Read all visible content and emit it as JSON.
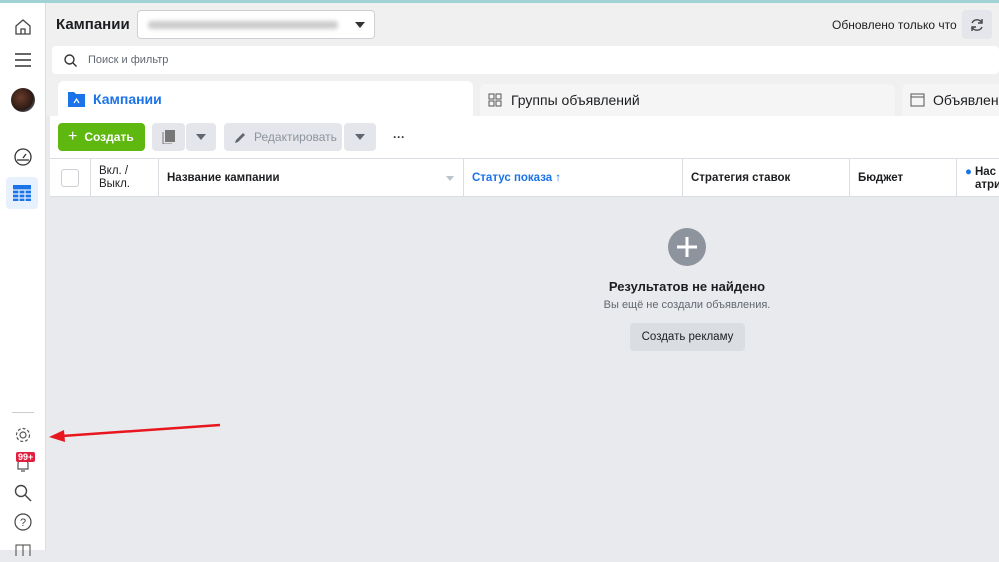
{
  "header": {
    "title": "Кампании",
    "updated": "Обновлено только что"
  },
  "search": {
    "placeholder": "Поиск и фильтр"
  },
  "tabs": [
    {
      "label": "Кампании"
    },
    {
      "label": "Группы объявлений"
    },
    {
      "label": "Объявлен"
    }
  ],
  "toolbar": {
    "create": "Создать",
    "edit": "Редактировать",
    "more": "···"
  },
  "table": {
    "columns": [
      "Вкл. / Выкл.",
      "Название кампании",
      "Статус показа",
      "Стратегия ставок",
      "Бюджет",
      "Нас атрибу"
    ]
  },
  "empty": {
    "title": "Результатов не найдено",
    "subtitle": "Вы ещё не создали объявления.",
    "button": "Создать рекламу"
  },
  "sidebar": {
    "badge": "99+"
  },
  "colors": {
    "accent": "#1a73e8",
    "create": "#5fb80f",
    "arrow": "#e8171f"
  }
}
